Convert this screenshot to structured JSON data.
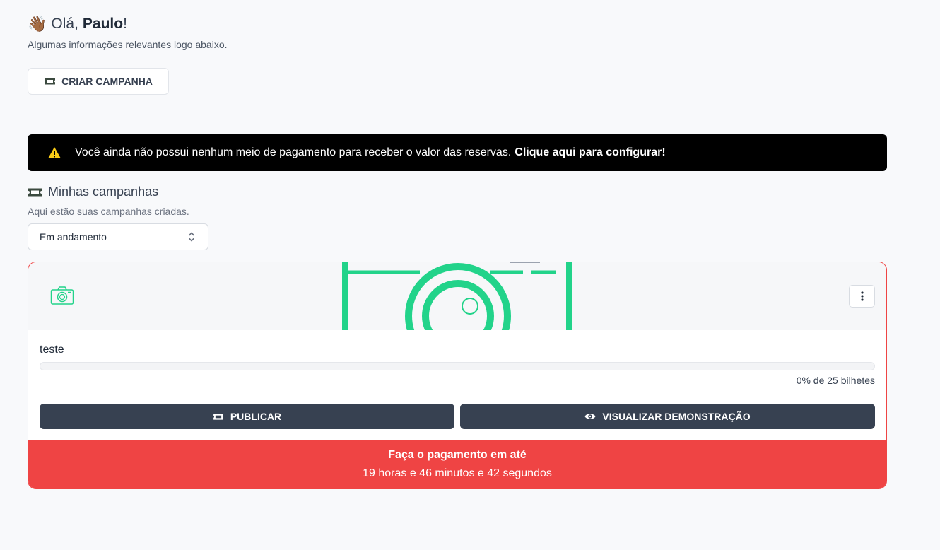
{
  "header": {
    "greeting_prefix": "Olá,",
    "user_name": "Paulo",
    "greeting_suffix": "!",
    "subtitle": "Algumas informações relevantes logo abaixo.",
    "create_button_label": "CRIAR CAMPANHA"
  },
  "alert": {
    "message": "Você ainda não possui nenhum meio de pagamento para receber o valor das reservas.",
    "link_text": "Clique aqui para configurar!"
  },
  "campaigns": {
    "title": "Minhas campanhas",
    "subtitle": "Aqui estão suas campanhas criadas.",
    "filter_selected": "Em andamento",
    "items": [
      {
        "name": "teste",
        "progress_fraction": 0,
        "progress_text": "0% de 25 bilhetes",
        "publish_label": "PUBLICAR",
        "demo_label": "VISUALIZAR DEMONSTRAÇÃO",
        "payment_title": "Faça o pagamento em até",
        "payment_countdown": "19 horas e 46 minutos e 42 segundos"
      }
    ]
  },
  "icons": {
    "hand": "waving-hand-icon",
    "ticket": "ticket-icon",
    "warning": "warning-icon",
    "camera": "camera-icon",
    "menu": "vertical-dots-icon",
    "eye": "eye-icon",
    "select": "chevron-up-down-icon"
  },
  "colors": {
    "alert_bg": "#000000",
    "card_border": "#ef4444",
    "footer_bg": "#ef4444",
    "button_bg": "#374151",
    "camera_green": "#22d38a",
    "warning_yellow": "#facc15"
  }
}
